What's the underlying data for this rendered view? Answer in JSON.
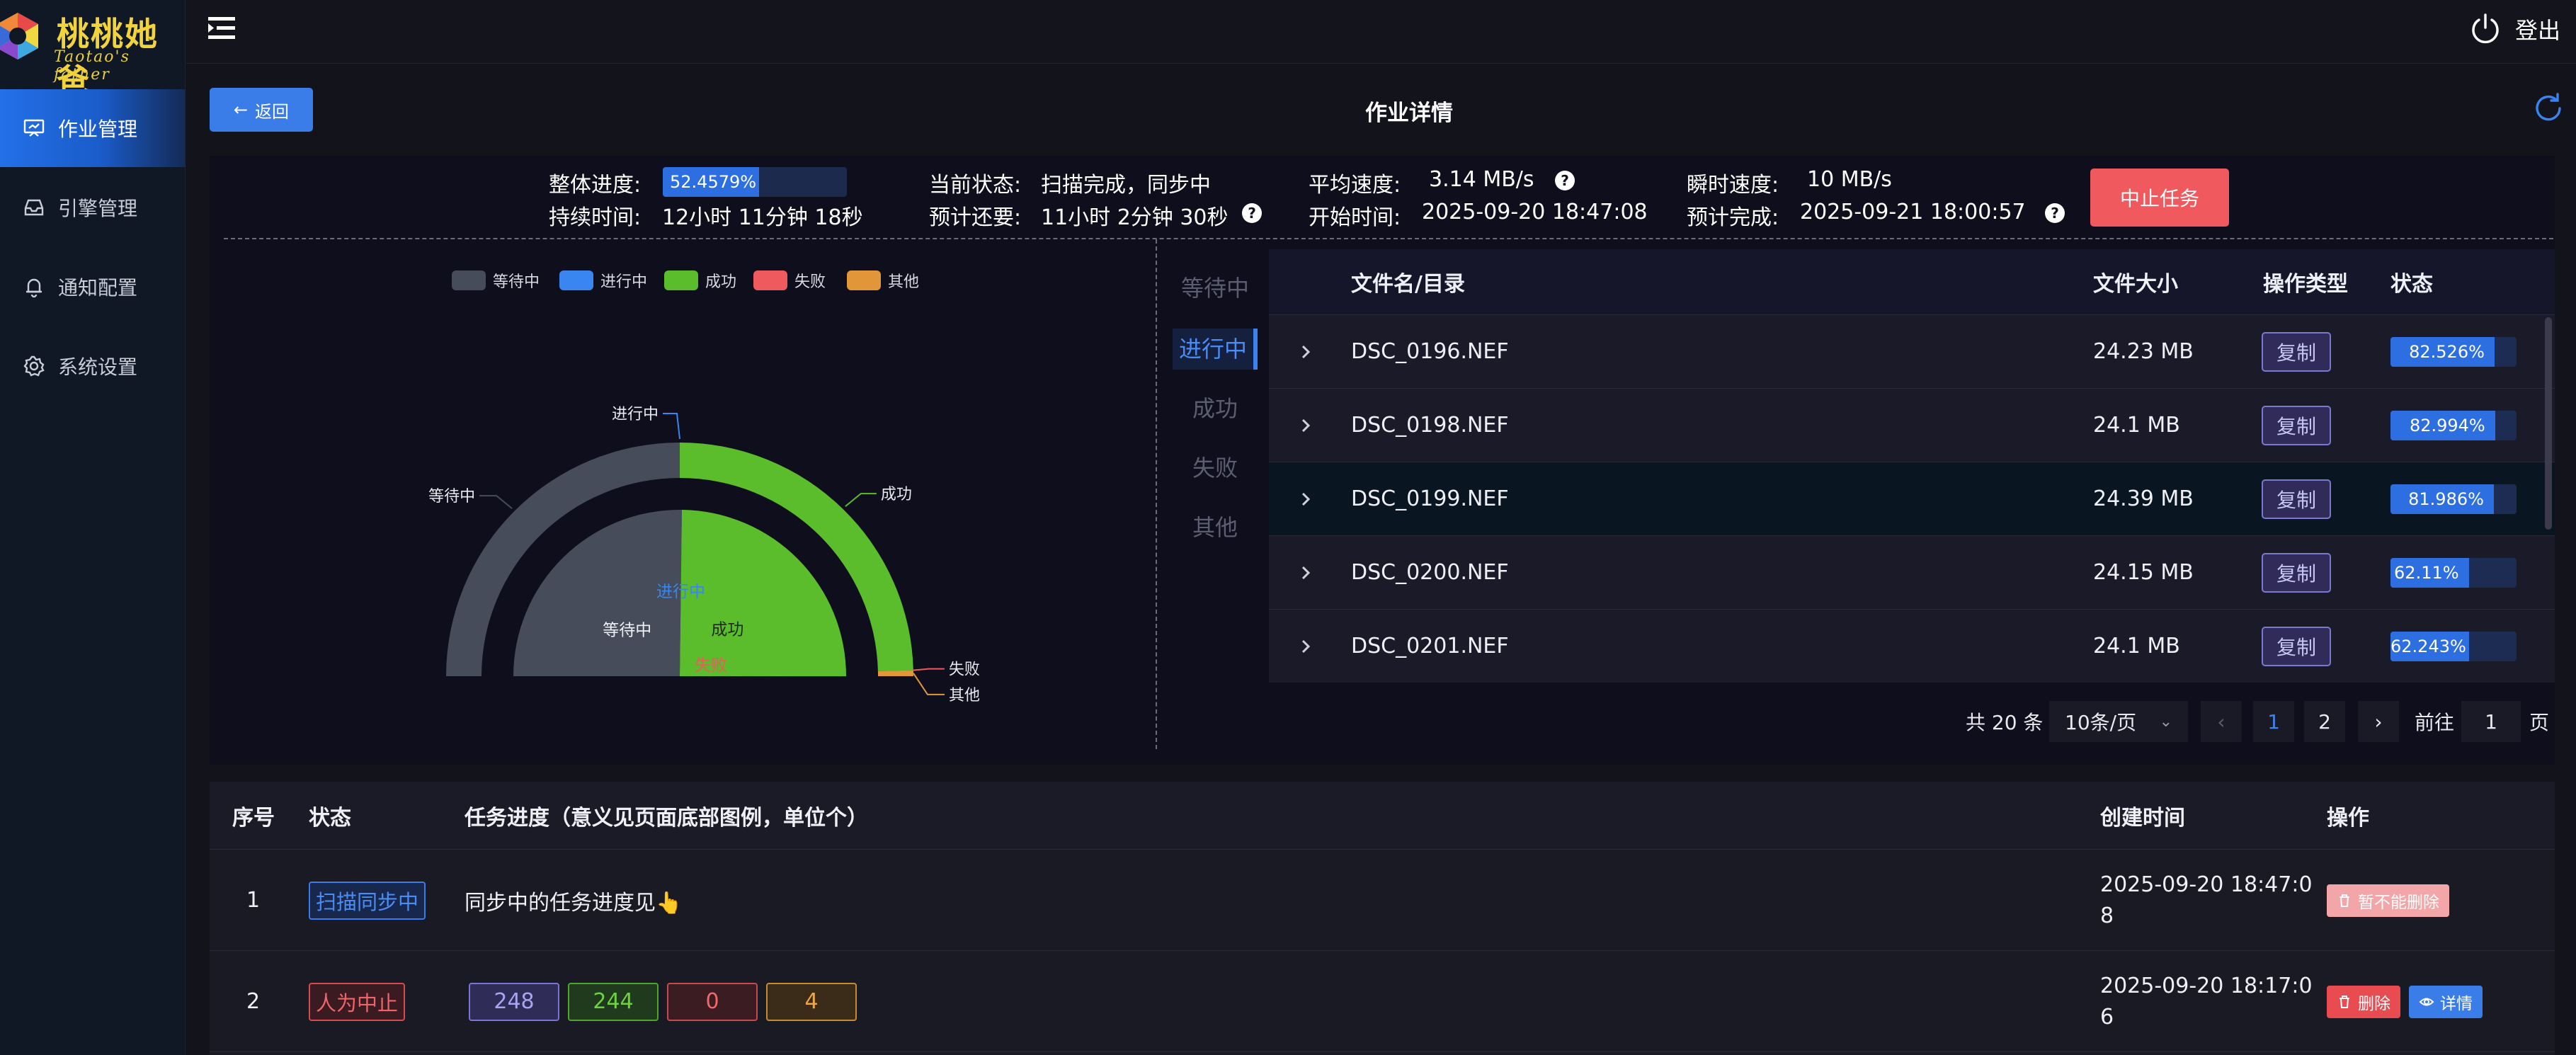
{
  "app": {
    "logo_cn": "桃桃她爸",
    "logo_en": "Taotao's father",
    "logout_label": "登出"
  },
  "sidebar": {
    "items": [
      {
        "label": "作业管理",
        "icon": "presentation-board-icon",
        "active": true
      },
      {
        "label": "引擎管理",
        "icon": "inbox-icon",
        "active": false
      },
      {
        "label": "通知配置",
        "icon": "bell-icon",
        "active": false
      },
      {
        "label": "系统设置",
        "icon": "gear-icon",
        "active": false
      }
    ]
  },
  "header": {
    "back_label": "返回",
    "title": "作业详情"
  },
  "summary": {
    "progress_label": "整体进度:",
    "progress_value": "52.4579%",
    "progress_fraction": 0.524579,
    "status_label": "当前状态:",
    "status_value": "扫描完成，同步中",
    "avg_speed_label": "平均速度:",
    "avg_speed_value": "3.14 MB/s",
    "inst_speed_label": "瞬时速度:",
    "inst_speed_value": "10 MB/s",
    "duration_label": "持续时间:",
    "duration_value": "12小时 11分钟 18秒",
    "remaining_label": "预计还要:",
    "remaining_value": "11小时 2分钟 30秒",
    "start_label": "开始时间:",
    "start_value": "2025-09-20 18:47:08",
    "finish_label": "预计完成:",
    "finish_value": "2025-09-21 18:00:57",
    "stop_label": "中止任务",
    "help_glyph": "?"
  },
  "chart_data": {
    "type": "pie",
    "variant": "nested-half-donut",
    "legend": [
      "等待中",
      "进行中",
      "成功",
      "失败",
      "其他"
    ],
    "colors": {
      "等待中": "#464c59",
      "进行中": "#3a86f0",
      "成功": "#5bbd2c",
      "失败": "#ef5a5e",
      "其他": "#e2963a"
    },
    "outer_labels": [
      "等待中",
      "进行中",
      "成功",
      "失败",
      "其他"
    ],
    "inner_labels": [
      "等待中",
      "进行中",
      "成功",
      "失败"
    ],
    "outer_values": [
      248,
      0,
      244,
      0,
      4
    ],
    "inner_values": [
      248,
      0,
      244,
      0
    ]
  },
  "status_tabs": [
    {
      "label": "等待中",
      "active": false
    },
    {
      "label": "进行中",
      "active": true
    },
    {
      "label": "成功",
      "active": false
    },
    {
      "label": "失败",
      "active": false
    },
    {
      "label": "其他",
      "active": false
    }
  ],
  "file_table": {
    "columns": [
      "文件名/目录",
      "文件大小",
      "操作类型",
      "状态"
    ],
    "rows": [
      {
        "name": "DSC_0196.NEF",
        "size": "24.23 MB",
        "op": "复制",
        "progress": "82.526%",
        "fraction": 0.82526
      },
      {
        "name": "DSC_0198.NEF",
        "size": "24.1 MB",
        "op": "复制",
        "progress": "82.994%",
        "fraction": 0.82994
      },
      {
        "name": "DSC_0199.NEF",
        "size": "24.39 MB",
        "op": "复制",
        "progress": "81.986%",
        "fraction": 0.81986
      },
      {
        "name": "DSC_0200.NEF",
        "size": "24.15 MB",
        "op": "复制",
        "progress": "62.11%",
        "fraction": 0.6211
      },
      {
        "name": "DSC_0201.NEF",
        "size": "24.1 MB",
        "op": "复制",
        "progress": "62.243%",
        "fraction": 0.62243
      }
    ]
  },
  "pagination": {
    "total_text": "共 20 条",
    "page_size": "10条/页",
    "prev": "‹",
    "pages": [
      "1",
      "2"
    ],
    "next": "›",
    "goto_label": "前往",
    "goto_value": "1",
    "goto_suffix": "页"
  },
  "task_table": {
    "columns": [
      "序号",
      "状态",
      "任务进度（意义见页面底部图例，单位个）",
      "创建时间",
      "操作"
    ],
    "rows": [
      {
        "index": "1",
        "status": "扫描同步中",
        "progress_text": "同步中的任务进度见👆",
        "created_line1": "2025-09-20 18:47:0",
        "created_line2": "8",
        "action": "暂不能删除"
      },
      {
        "index": "2",
        "status": "人为中止",
        "counts": [
          "248",
          "244",
          "0",
          "4"
        ],
        "created_line1": "2025-09-20 18:17:0",
        "created_line2": "6",
        "delete_label": "删除",
        "detail_label": "详情"
      }
    ]
  }
}
